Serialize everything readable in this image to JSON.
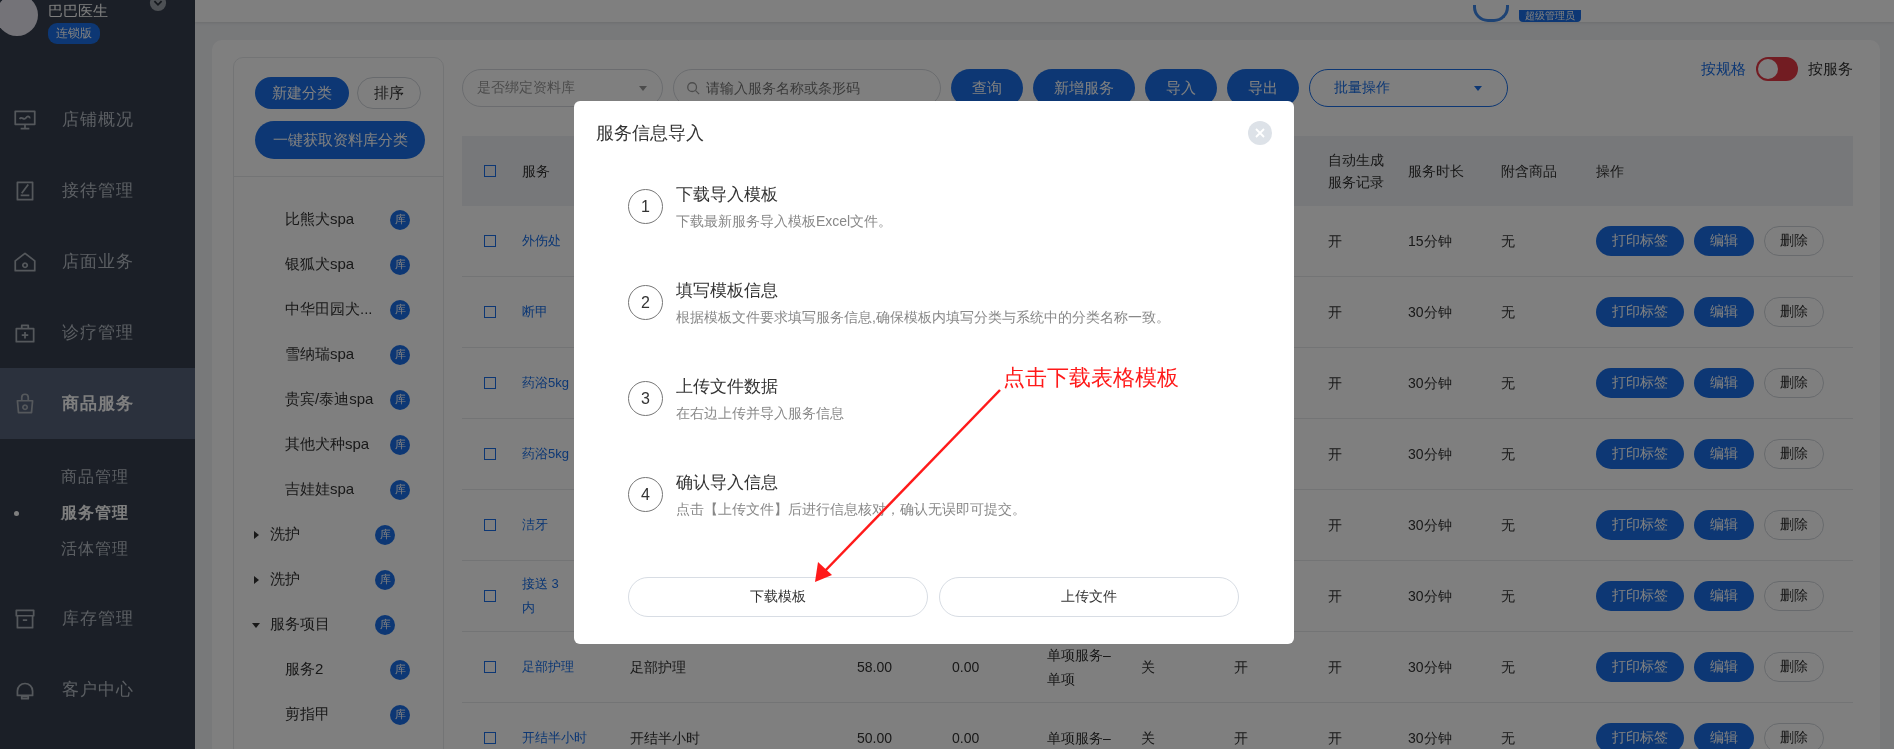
{
  "sidebar": {
    "user_name": "巴巴医生",
    "edition_badge": "连锁版",
    "nav": [
      {
        "label": "店铺概况",
        "selected": false
      },
      {
        "label": "接待管理",
        "selected": false
      },
      {
        "label": "店面业务",
        "selected": false
      },
      {
        "label": "诊疗管理",
        "selected": false
      },
      {
        "label": "商品服务",
        "selected": true,
        "children": [
          {
            "label": "商品管理",
            "selected": false
          },
          {
            "label": "服务管理",
            "selected": true
          },
          {
            "label": "活体管理",
            "selected": false
          }
        ]
      },
      {
        "label": "库存管理",
        "selected": false
      },
      {
        "label": "客户中心",
        "selected": false
      }
    ]
  },
  "header": {
    "role_badge": "超级管理员"
  },
  "category_panel": {
    "buttons": [
      {
        "label": "新建分类",
        "kind": "primary"
      },
      {
        "label": "排序",
        "kind": "outline"
      },
      {
        "label": "一键获取资料库分类",
        "kind": "primary"
      }
    ],
    "tree": [
      {
        "children": [
          {
            "label": "比熊犬spa",
            "badge": "库"
          },
          {
            "label": "银狐犬spa",
            "badge": "库"
          },
          {
            "label": "中华田园犬...",
            "badge": "库"
          },
          {
            "label": "雪纳瑞spa",
            "badge": "库"
          },
          {
            "label": "贵宾/泰迪spa",
            "badge": "库"
          },
          {
            "label": "其他犬种spa",
            "badge": "库"
          },
          {
            "label": "吉娃娃spa",
            "badge": "库"
          }
        ]
      },
      {
        "label": "洗护",
        "badge": "库",
        "expanded": false
      },
      {
        "label": "洗护",
        "badge": "库",
        "expanded": false
      },
      {
        "label": "服务项目",
        "badge": "库",
        "expanded": true,
        "children": [
          {
            "label": "服务2",
            "badge": "库"
          },
          {
            "label": "剪指甲",
            "badge": "库"
          }
        ]
      }
    ]
  },
  "toolbar": {
    "bind_select": {
      "placeholder": "是否绑定资料库"
    },
    "search": {
      "placeholder": "请输入服务名称或条形码"
    },
    "buttons": [
      "查询",
      "新增服务",
      "导入",
      "导出"
    ],
    "batch_select": {
      "placeholder": "批量操作"
    },
    "view_toggle": [
      {
        "label": "按规格",
        "selected": true
      },
      {
        "label": "按服务",
        "selected": false
      }
    ]
  },
  "table": {
    "select_all": {
      "checked": false
    },
    "columns": [
      "服务",
      "自动生成服务记录",
      "服务时长",
      "附含商品",
      "操作"
    ],
    "rows": [
      {
        "checked": false,
        "service": "外伤处",
        "auto_record": "开",
        "duration": "15分钟",
        "goods": "无",
        "actions": [
          "打印标签",
          "编辑",
          "删除"
        ]
      },
      {
        "checked": false,
        "service": "断甲",
        "auto_record": "开",
        "duration": "30分钟",
        "goods": "无",
        "actions": [
          "打印标签",
          "编辑",
          "删除"
        ]
      },
      {
        "checked": false,
        "service": "药浴5kg",
        "auto_record": "开",
        "duration": "30分钟",
        "goods": "无",
        "actions": [
          "打印标签",
          "编辑",
          "删除"
        ]
      },
      {
        "checked": false,
        "service": "药浴5kg",
        "auto_record": "开",
        "duration": "30分钟",
        "goods": "无",
        "actions": [
          "打印标签",
          "编辑",
          "删除"
        ]
      },
      {
        "checked": false,
        "service": "洁牙",
        "auto_record": "开",
        "duration": "30分钟",
        "goods": "无",
        "actions": [
          "打印标签",
          "编辑",
          "删除"
        ]
      },
      {
        "checked": false,
        "service": "接送 3",
        "service_wrap": "内",
        "auto_record": "开",
        "duration": "30分钟",
        "goods": "无",
        "actions": [
          "打印标签",
          "编辑",
          "删除"
        ]
      },
      {
        "checked": false,
        "service": "足部护理",
        "name": "足部护理",
        "price": "58.00",
        "cost": "0.00",
        "type": "单项服务–单项",
        "col_6": "关",
        "col_7": "开",
        "auto_record": "开",
        "duration": "30分钟",
        "goods": "无",
        "actions": [
          "打印标签",
          "编辑",
          "删除"
        ]
      },
      {
        "checked": false,
        "service": "开结半小时",
        "name": "开结半小时",
        "price": "50.00",
        "cost": "0.00",
        "type": "单项服务–",
        "col_6": "关",
        "col_7": "开",
        "auto_record": "开",
        "duration": "30分钟",
        "goods": "无",
        "actions": [
          "打印标签",
          "编辑",
          "删除"
        ]
      }
    ]
  },
  "modal": {
    "title": "服务信息导入",
    "steps": [
      {
        "number": "1",
        "title": "下载导入模板",
        "description": "下载最新服务导入模板Excel文件。"
      },
      {
        "number": "2",
        "title": "填写模板信息",
        "description": "根据模板文件要求填写服务信息,确保模板内填写分类与系统中的分类名称一致。"
      },
      {
        "number": "3",
        "title": "上传文件数据",
        "description": "在右边上传并导入服务信息"
      },
      {
        "number": "4",
        "title": "确认导入信息",
        "description": "点击【上传文件】后进行信息核对，确认无误即可提交。"
      }
    ],
    "buttons": [
      "下载模板",
      "上传文件"
    ]
  },
  "annotation": {
    "text": "点击下载表格模板"
  }
}
